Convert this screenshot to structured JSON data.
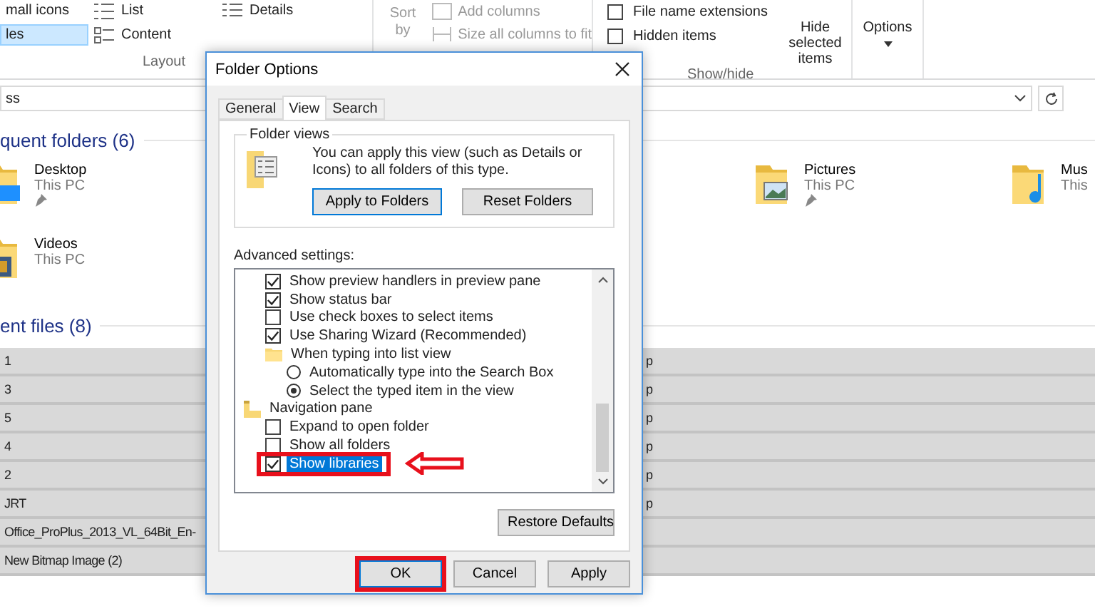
{
  "ribbon": {
    "layout": {
      "label": "Layout",
      "items": [
        {
          "label": "mall icons",
          "selected": false
        },
        {
          "label": "List",
          "selected": false
        },
        {
          "label": "Details",
          "selected": false
        },
        {
          "label": "les",
          "selected": true
        },
        {
          "label": "Content",
          "selected": false
        }
      ]
    },
    "current_view": {
      "sort_by": "Sort\nby",
      "add_columns": "Add columns",
      "size_columns": "Size all columns to fit"
    },
    "show_hide": {
      "label": "Show/hide",
      "checkboxes": [
        {
          "label": "File name extensions",
          "checked": false
        },
        {
          "label": "Hidden items",
          "checked": false
        }
      ],
      "hide_selected": "Hide selected\nitems"
    },
    "options": "Options"
  },
  "address": {
    "value": "ss"
  },
  "frequent_folders": {
    "title": "quent folders (6)",
    "items": [
      {
        "name": "Desktop",
        "location": "This PC",
        "pinned": true,
        "kind": "desktop"
      },
      {
        "name": "Pictures",
        "location": "This PC",
        "pinned": true,
        "kind": "pictures"
      },
      {
        "name": "Mus",
        "location": "This",
        "pinned": false,
        "kind": "music"
      },
      {
        "name": "Videos",
        "location": "This PC",
        "pinned": false,
        "kind": "videos"
      }
    ]
  },
  "recent_files": {
    "title": "ent files (8)",
    "rows": [
      {
        "name": "1",
        "column_2": "p",
        "selected": true
      },
      {
        "name": "3",
        "column_2": "p",
        "selected": true
      },
      {
        "name": "5",
        "column_2": "p",
        "selected": true
      },
      {
        "name": "4",
        "column_2": "p",
        "selected": true
      },
      {
        "name": "2",
        "column_2": "p",
        "selected": true
      },
      {
        "name": "JRT",
        "column_2": "p",
        "selected": true
      },
      {
        "name": "Office_ProPlus_2013_VL_64Bit_En-",
        "selected": true
      },
      {
        "name": "New Bitmap Image (2)",
        "selected": true
      }
    ]
  },
  "dialog": {
    "title": "Folder Options",
    "tabs": [
      {
        "label": "General",
        "selected": false
      },
      {
        "label": "View",
        "selected": true
      },
      {
        "label": "Search",
        "selected": false
      }
    ],
    "folder_views": {
      "title": "Folder views",
      "text": "You can apply this view (such as Details or Icons) to all folders of this type.",
      "apply": "Apply to Folders",
      "reset": "Reset Folders"
    },
    "advanced_label": "Advanced settings:",
    "advanced": [
      {
        "kind": "continued",
        "children": [
          {
            "kind": "checkbox",
            "label": "Show preview handlers in preview pane",
            "checked": true,
            "selected": false,
            "marked": false
          },
          {
            "kind": "checkbox",
            "label": "Show status bar",
            "checked": true,
            "selected": false,
            "marked": false
          },
          {
            "kind": "checkbox",
            "label": "Use check boxes to select items",
            "checked": false,
            "selected": false,
            "marked": false
          },
          {
            "kind": "checkbox",
            "label": "Use Sharing Wizard (Recommended)",
            "checked": true,
            "selected": false,
            "marked": false
          },
          {
            "kind": "folder",
            "label": "When typing into list view",
            "selected": false,
            "marked": false,
            "children": [
              {
                "kind": "radio",
                "label": "Automatically type into the Search Box",
                "checked": false,
                "selected": false,
                "marked": false
              },
              {
                "kind": "radio",
                "label": "Select the typed item in the view",
                "checked": true,
                "selected": false,
                "marked": false
              }
            ]
          }
        ]
      },
      {
        "kind": "navigation",
        "label": "Navigation pane",
        "selected": false,
        "marked": false,
        "children": [
          {
            "kind": "checkbox",
            "label": "Expand to open folder",
            "checked": false,
            "selected": false,
            "marked": false
          },
          {
            "kind": "checkbox",
            "label": "Show all folders",
            "checked": false,
            "selected": false,
            "marked": false
          },
          {
            "kind": "checkbox",
            "label": "Show libraries",
            "checked": true,
            "selected": true,
            "marked": true
          }
        ]
      }
    ],
    "restore": "Restore Defaults",
    "buttons": [
      {
        "label": "OK",
        "marked": true
      },
      {
        "label": "Cancel",
        "marked": false
      },
      {
        "label": "Apply",
        "marked": false
      }
    ]
  }
}
